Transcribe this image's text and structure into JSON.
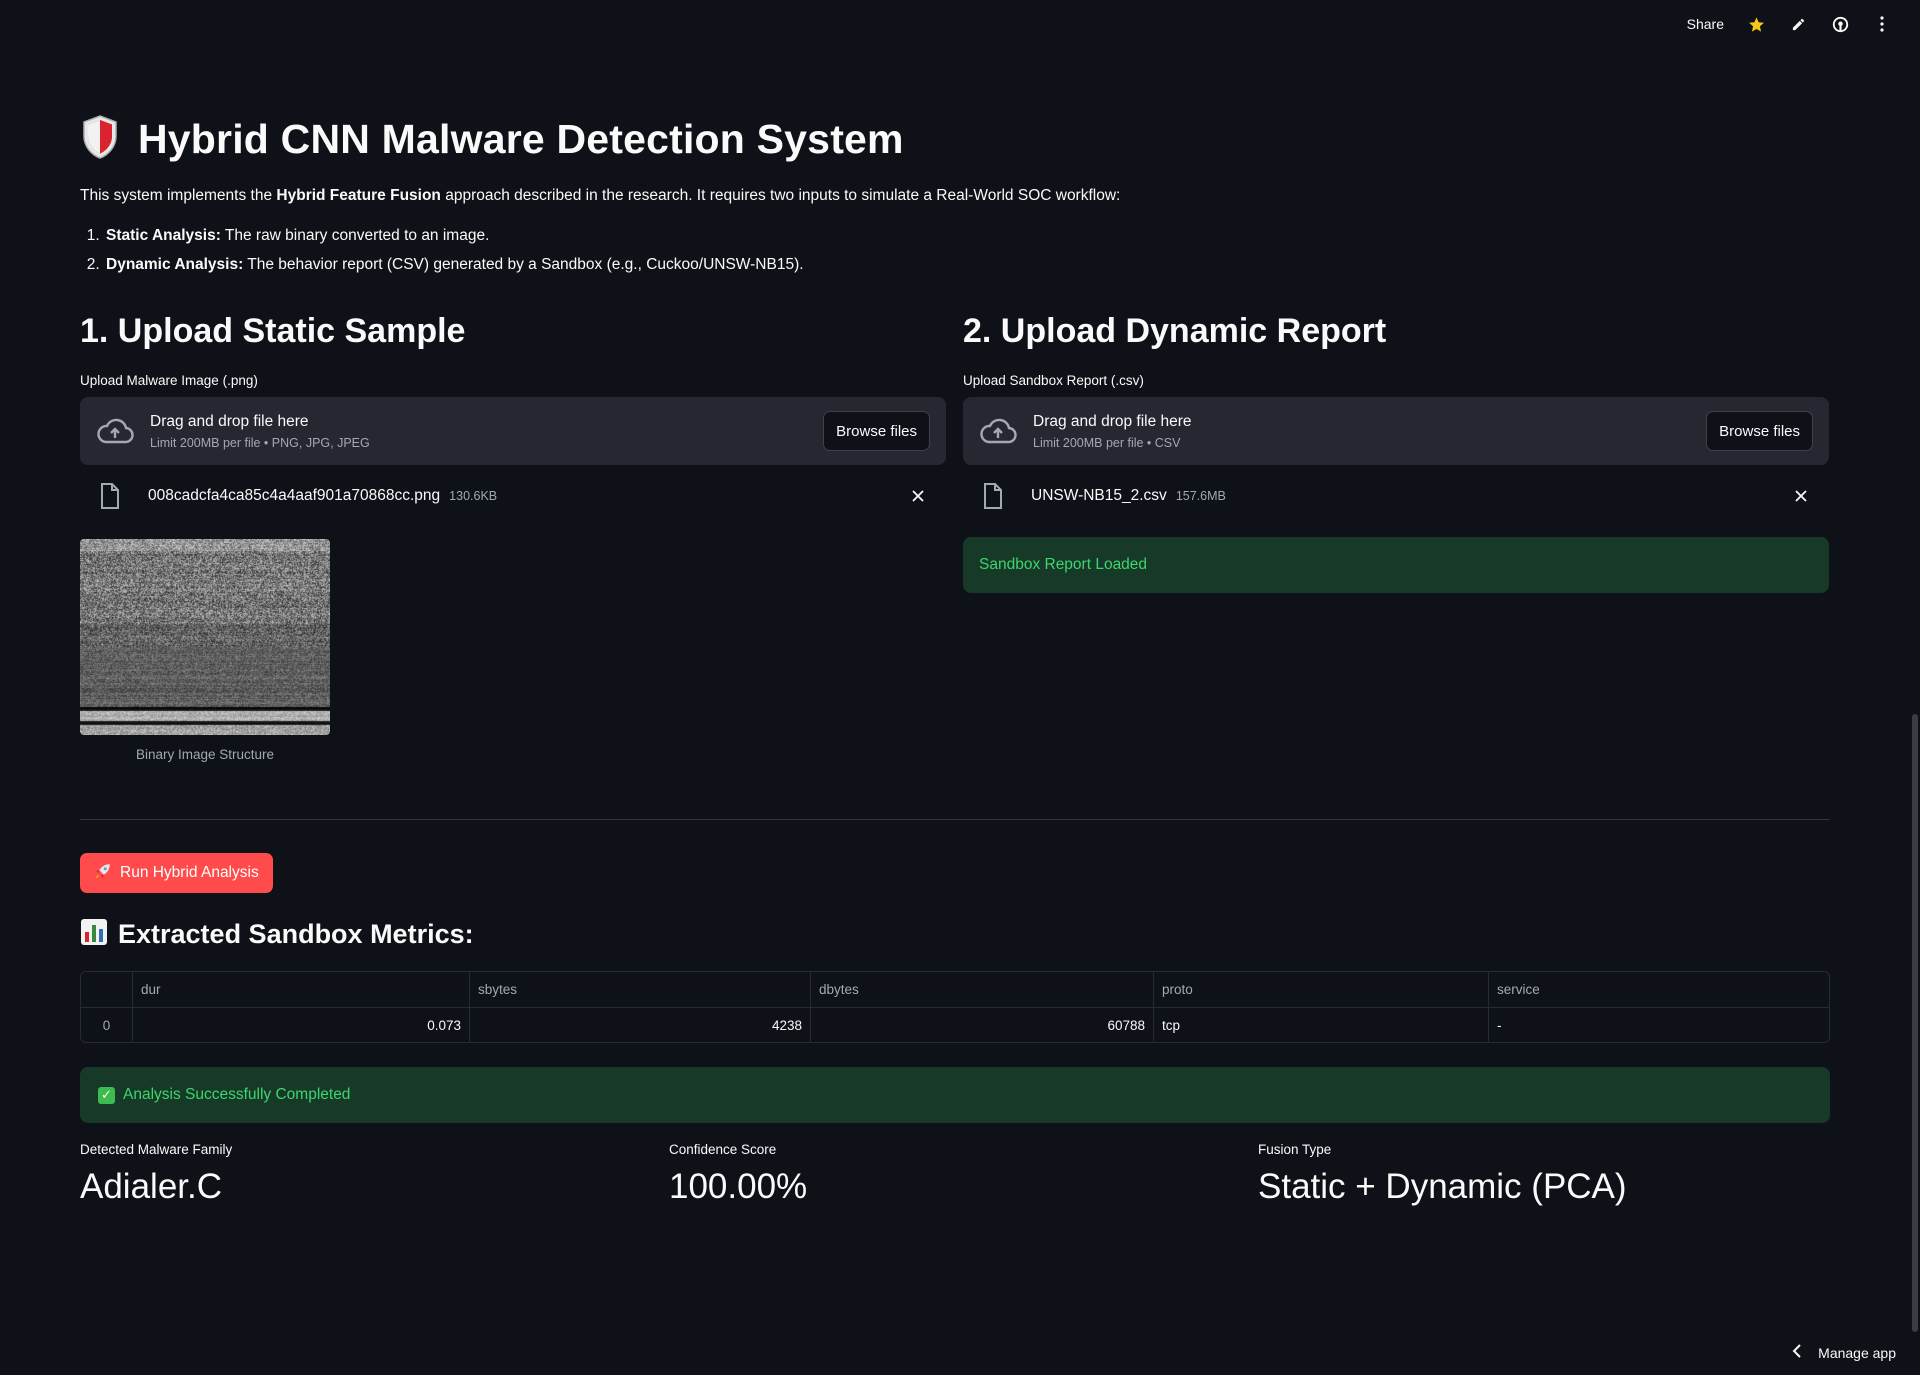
{
  "toolbar": {
    "share_label": "Share",
    "icons": [
      "star-icon",
      "edit-icon",
      "github-icon",
      "more-vert-icon"
    ]
  },
  "header": {
    "title": "Hybrid CNN Malware Detection System",
    "icon": "shield-icon"
  },
  "intro": {
    "prefix": "This system implements the ",
    "bold": "Hybrid Feature Fusion",
    "suffix": " approach described in the research. It requires two inputs to simulate a Real-World SOC workflow:",
    "steps": [
      {
        "bold": "Static Analysis:",
        "text": " The raw binary converted to an image."
      },
      {
        "bold": "Dynamic Analysis:",
        "text": " The behavior report (CSV) generated by a Sandbox (e.g., Cuckoo/UNSW-NB15)."
      }
    ]
  },
  "static_section": {
    "heading": "1. Upload Static Sample",
    "upload_label": "Upload Malware Image (.png)",
    "drop_text": "Drag and drop file here",
    "limit_text": "Limit 200MB per file • PNG, JPG, JPEG",
    "browse_label": "Browse files",
    "file_name": "008cadcfa4ca85c4a4aaf901a70868cc.png",
    "file_size": "130.6KB",
    "image_caption": "Binary Image Structure"
  },
  "dynamic_section": {
    "heading": "2. Upload Dynamic Report",
    "upload_label": "Upload Sandbox Report (.csv)",
    "drop_text": "Drag and drop file here",
    "limit_text": "Limit 200MB per file • CSV",
    "browse_label": "Browse files",
    "file_name": "UNSW-NB15_2.csv",
    "file_size": "157.6MB",
    "status": "Sandbox Report Loaded"
  },
  "run_button": {
    "label": "Run Hybrid Analysis",
    "icon": "rocket-icon"
  },
  "metrics_table": {
    "heading": "Extracted Sandbox Metrics:",
    "icon": "bar-chart-icon",
    "columns": [
      "",
      "dur",
      "sbytes",
      "dbytes",
      "proto",
      "service"
    ],
    "rows": [
      [
        "0",
        "0.073",
        "4238",
        "60788",
        "tcp",
        "-"
      ]
    ]
  },
  "result": {
    "status": "Analysis Successfully Completed",
    "metrics": [
      {
        "label": "Detected Malware Family",
        "value": "Adialer.C"
      },
      {
        "label": "Confidence Score",
        "value": "100.00%"
      },
      {
        "label": "Fusion Type",
        "value": "Static + Dynamic (PCA)"
      }
    ]
  },
  "footer": {
    "manage_label": "Manage app"
  },
  "colors": {
    "background": "#0e1117",
    "primary_button": "#ff4b4b",
    "success_bg": "#173928",
    "success_text": "#3dd56d",
    "widget_bg": "#262730"
  }
}
